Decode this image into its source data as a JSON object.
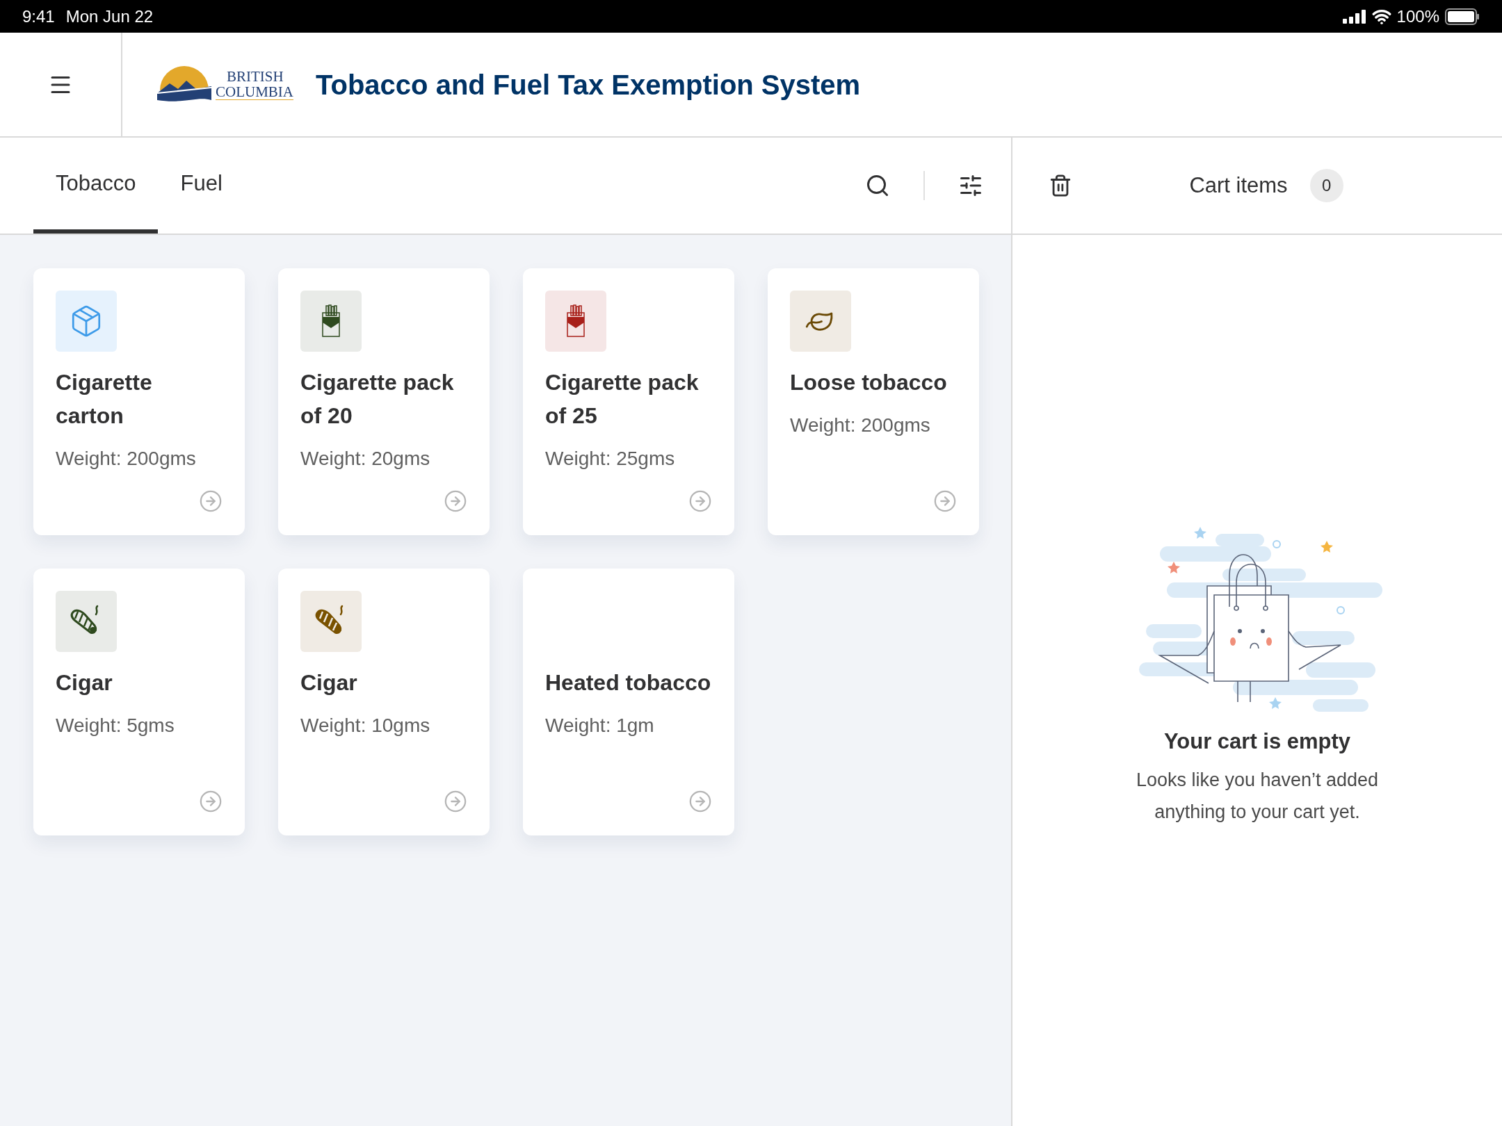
{
  "status_bar": {
    "time": "9:41",
    "date": "Mon Jun 22",
    "battery": "100%"
  },
  "header": {
    "logo_lines": [
      "BRITISH",
      "COLUMBIA"
    ],
    "title": "Tobacco and Fuel Tax Exemption System"
  },
  "tabs": [
    {
      "label": "Tobacco",
      "selected": true
    },
    {
      "label": "Fuel",
      "selected": false
    }
  ],
  "products": [
    {
      "kind": "carton",
      "name": "Cigarette carton",
      "weight": "Weight: 200gms"
    },
    {
      "kind": "pack",
      "name": "Cigarette pack of 20",
      "weight": "Weight: 20gms"
    },
    {
      "kind": "pack",
      "name": "Cigarette pack of 25",
      "weight": "Weight: 25gms"
    },
    {
      "kind": "loose",
      "name": "Loose tobacco",
      "weight": "Weight: 200gms"
    },
    {
      "kind": "cigar",
      "name": "Cigar",
      "weight": "Weight: 5gms"
    },
    {
      "kind": "cigar",
      "name": "Cigar",
      "weight": "Weight: 10gms"
    },
    {
      "kind": "heated",
      "name": "Heated tobacco",
      "weight": "Weight: 1gm"
    }
  ],
  "cart": {
    "title": "Cart items",
    "count": "0",
    "empty_title": "Your cart is empty",
    "empty_message": "Looks like you haven’t added anything to your cart yet."
  }
}
